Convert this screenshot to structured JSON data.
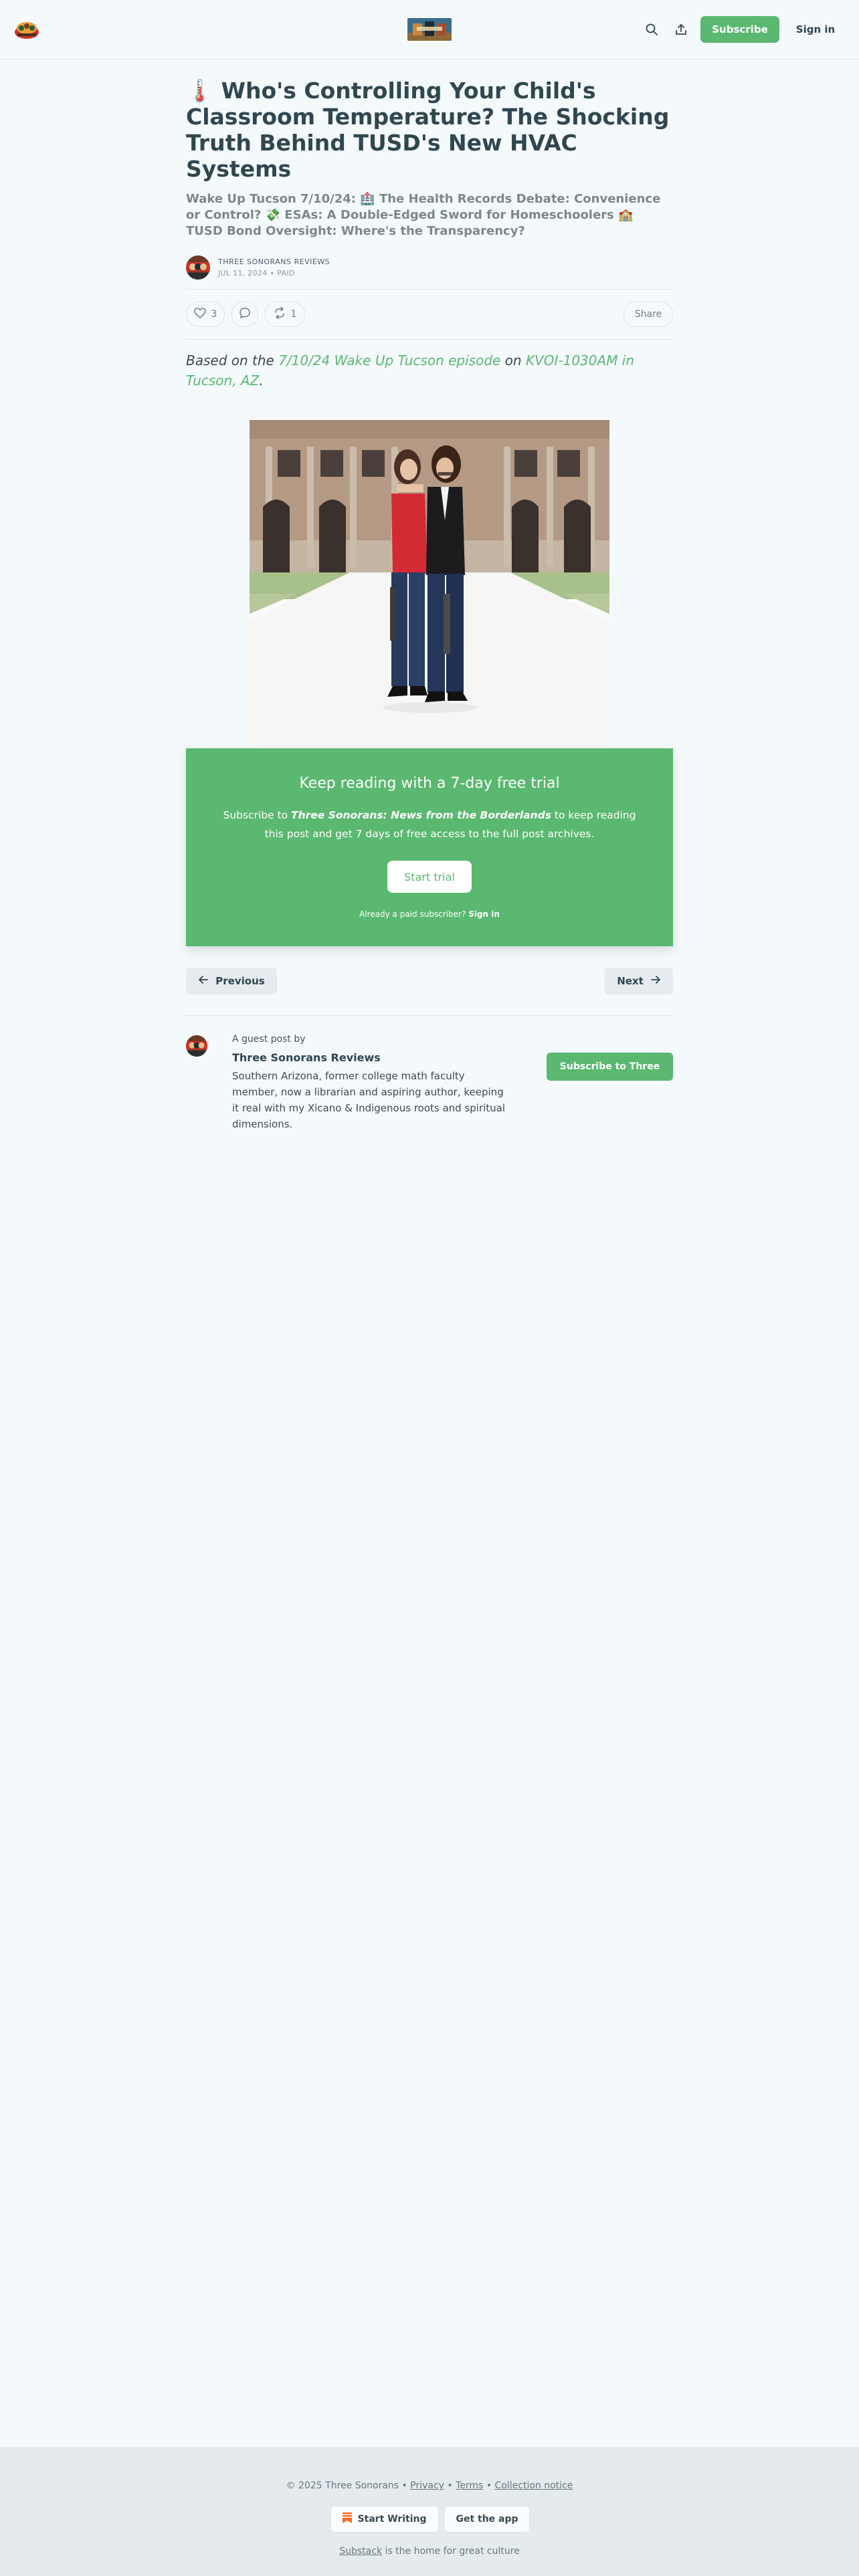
{
  "header": {
    "logo_icon": "three-sonorans-logo-icon",
    "search_icon": "search-icon",
    "share_icon": "share-icon",
    "subscribe_label": "Subscribe",
    "signin_label": "Sign in",
    "accent_color": "#5ab870"
  },
  "article": {
    "title": "🌡️ Who's Controlling Your Child's Classroom Temperature? The Shocking Truth Behind TUSD's New HVAC Systems",
    "subtitle": "Wake Up Tucson 7/10/24: 🏥 The Health Records Debate: Convenience or Control? 💸 ESAs: A Double-Edged Sword for Homeschoolers 🏫 TUSD Bond Oversight: Where's the Transparency?",
    "author": "THREE SONORANS REVIEWS",
    "date": "JUL 11, 2024",
    "access": "PAID",
    "likes": "3",
    "restacks": "1",
    "share_label": "Share",
    "lede_prefix": "Based on the ",
    "lede_link1": "7/10/24 Wake Up Tucson episode",
    "lede_middle": " on ",
    "lede_link2": "KVOI-1030AM in Tucson, AZ",
    "lede_suffix": "."
  },
  "paywall": {
    "title": "Keep reading with a 7-day free trial",
    "text_prefix": "Subscribe to ",
    "publication": "Three Sonorans: News from the Borderlands",
    "text_suffix": " to keep reading this post and get 7 days of free access to the full post archives.",
    "button": "Start trial",
    "already": "Already a paid subscriber? ",
    "signin": "Sign in"
  },
  "post_nav": {
    "previous": "Previous",
    "next": "Next"
  },
  "guest": {
    "label": "A guest post by",
    "name": "Three Sonorans Reviews",
    "bio": "Southern Arizona, former college math faculty member, now a librarian and aspiring author, keeping it real with my Xicano & Indigenous roots and spiritual dimensions.",
    "button": "Subscribe to Three"
  },
  "footer": {
    "copyright": "© 2025 Three Sonorans",
    "sep": " • ",
    "privacy": "Privacy",
    "terms": "Terms",
    "collection": "Collection notice",
    "start_writing": "Start Writing",
    "get_app": "Get the app",
    "tag_link": "Substack",
    "tag_rest": " is the home for great culture"
  }
}
